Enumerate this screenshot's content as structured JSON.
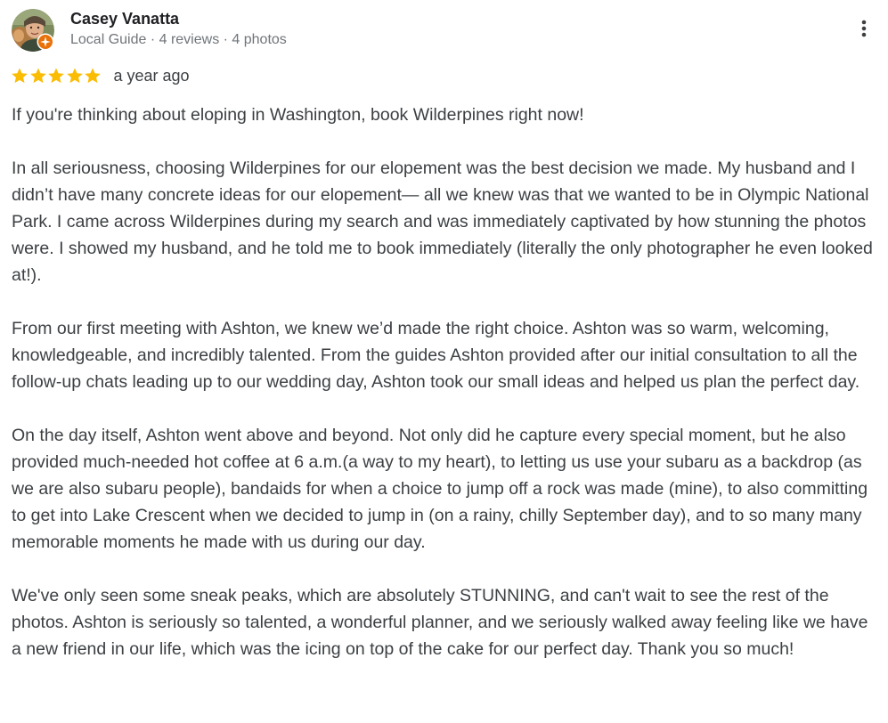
{
  "author": {
    "name": "Casey Vanatta",
    "meta": "Local Guide · 4 reviews · 4 photos"
  },
  "rating": {
    "stars": 5,
    "max": 5,
    "date": "a year ago"
  },
  "icons": {
    "avatar": "user-avatar-photo",
    "badge": "local-guide-badge-icon",
    "more": "more-vert-icon",
    "star": "star-icon"
  },
  "colors": {
    "star": "#fbbc04",
    "badge": "#e8710a",
    "name": "#202124",
    "meta": "#70757a",
    "text": "#3c4043"
  },
  "review": {
    "paragraphs": [
      "If you're thinking about eloping in Washington, book Wilderpines right now!",
      "In all seriousness, choosing Wilderpines for our elopement was the best decision we made. My husband and I didn’t have many concrete ideas for our elopement— all we knew was that we wanted to be in Olympic National Park. I came across Wilderpines during my search and was immediately captivated by how stunning the photos were. I showed my husband, and he told me to book immediately (literally the only photographer he even looked at!).",
      "From our first meeting with Ashton, we knew we’d made the right choice. Ashton was so warm, welcoming, knowledgeable, and incredibly talented. From the guides Ashton provided after our initial consultation to all the follow-up chats leading up to our wedding day, Ashton took our small ideas and helped us plan the perfect day.",
      "On the day itself, Ashton went above and beyond. Not only did he capture every special moment, but he also provided much-needed hot coffee at 6 a.m.(a way to my heart), to letting us use your subaru as a backdrop (as we are also subaru people), bandaids for when a choice to jump off a rock was made (mine), to also committing to get into Lake Crescent when we decided to jump in (on a rainy, chilly September day), and to so many many memorable moments he made with us during our day.",
      "We've only seen some sneak peaks, which are absolutely STUNNING, and can't wait to see the rest of the photos. Ashton is seriously so talented, a wonderful planner, and we seriously walked away feeling like we have a new friend in our life, which was the icing on top of the cake for our perfect day. Thank you so much!"
    ]
  }
}
